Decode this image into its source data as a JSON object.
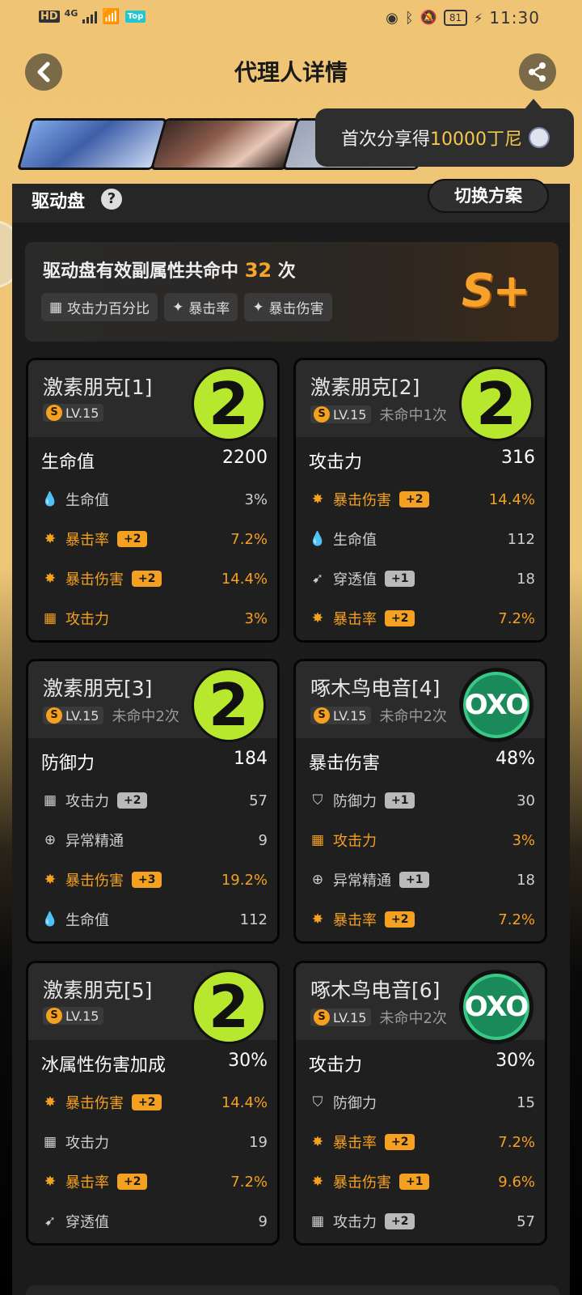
{
  "status_bar": {
    "hd": "HD",
    "net": "4G",
    "top_badge": "Top",
    "battery": "81",
    "time": "11:30"
  },
  "header": {
    "title": "代理人详情",
    "back_icon": "chevron-left-icon",
    "share_icon": "share-icon"
  },
  "tooltip": {
    "prefix": "首次分享得",
    "amount": "10000丁尼"
  },
  "panel": {
    "title": "驱动盘",
    "help": "?",
    "switch_label": "切换方案"
  },
  "summary": {
    "text_prefix": "驱动盘有效副属性共命中",
    "count": "32",
    "text_suffix": "次",
    "tags": [
      "攻击力百分比",
      "暴击率",
      "暴击伤害"
    ],
    "rank": "S+"
  },
  "discs": [
    {
      "name": "激素朋克[1]",
      "level": "LV.15",
      "miss": "",
      "logo": "2",
      "logo_type": "lime",
      "main": {
        "label": "生命值",
        "value": "2200"
      },
      "subs": [
        {
          "icon": "hp-icon",
          "label": "生命值",
          "plus": "",
          "value": "3%",
          "hit": false
        },
        {
          "icon": "crit-rate-icon",
          "label": "暴击率",
          "plus": "+2",
          "value": "7.2%",
          "hit": true
        },
        {
          "icon": "crit-dmg-icon",
          "label": "暴击伤害",
          "plus": "+2",
          "value": "14.4%",
          "hit": true
        },
        {
          "icon": "atk-icon",
          "label": "攻击力",
          "plus": "",
          "value": "3%",
          "hit": true
        }
      ]
    },
    {
      "name": "激素朋克[2]",
      "level": "LV.15",
      "miss": "未命中1次",
      "logo": "2",
      "logo_type": "lime",
      "main": {
        "label": "攻击力",
        "value": "316"
      },
      "subs": [
        {
          "icon": "crit-dmg-icon",
          "label": "暴击伤害",
          "plus": "+2",
          "value": "14.4%",
          "hit": true
        },
        {
          "icon": "hp-icon",
          "label": "生命值",
          "plus": "",
          "value": "112",
          "hit": false
        },
        {
          "icon": "pen-icon",
          "label": "穿透值",
          "plus": "+1",
          "value": "18",
          "hit": false
        },
        {
          "icon": "crit-rate-icon",
          "label": "暴击率",
          "plus": "+2",
          "value": "7.2%",
          "hit": true
        }
      ]
    },
    {
      "name": "激素朋克[3]",
      "level": "LV.15",
      "miss": "未命中2次",
      "logo": "2",
      "logo_type": "lime",
      "main": {
        "label": "防御力",
        "value": "184"
      },
      "subs": [
        {
          "icon": "atk-icon",
          "label": "攻击力",
          "plus": "+2",
          "value": "57",
          "hit": false
        },
        {
          "icon": "anomaly-icon",
          "label": "异常精通",
          "plus": "",
          "value": "9",
          "hit": false
        },
        {
          "icon": "crit-dmg-icon",
          "label": "暴击伤害",
          "plus": "+3",
          "value": "19.2%",
          "hit": true
        },
        {
          "icon": "hp-icon",
          "label": "生命值",
          "plus": "",
          "value": "112",
          "hit": false
        }
      ]
    },
    {
      "name": "啄木鸟电音[4]",
      "level": "LV.15",
      "miss": "未命中2次",
      "logo": "OXO",
      "logo_type": "oxo",
      "main": {
        "label": "暴击伤害",
        "value": "48%"
      },
      "subs": [
        {
          "icon": "def-icon",
          "label": "防御力",
          "plus": "+1",
          "value": "30",
          "hit": false
        },
        {
          "icon": "atk-icon",
          "label": "攻击力",
          "plus": "",
          "value": "3%",
          "hit": true
        },
        {
          "icon": "anomaly-icon",
          "label": "异常精通",
          "plus": "+1",
          "value": "18",
          "hit": false
        },
        {
          "icon": "crit-rate-icon",
          "label": "暴击率",
          "plus": "+2",
          "value": "7.2%",
          "hit": true
        }
      ]
    },
    {
      "name": "激素朋克[5]",
      "level": "LV.15",
      "miss": "",
      "logo": "2",
      "logo_type": "lime",
      "main": {
        "label": "冰属性伤害加成",
        "value": "30%"
      },
      "subs": [
        {
          "icon": "crit-dmg-icon",
          "label": "暴击伤害",
          "plus": "+2",
          "value": "14.4%",
          "hit": true
        },
        {
          "icon": "atk-icon",
          "label": "攻击力",
          "plus": "",
          "value": "19",
          "hit": false
        },
        {
          "icon": "crit-rate-icon",
          "label": "暴击率",
          "plus": "+2",
          "value": "7.2%",
          "hit": true
        },
        {
          "icon": "pen-icon",
          "label": "穿透值",
          "plus": "",
          "value": "9",
          "hit": false
        }
      ]
    },
    {
      "name": "啄木鸟电音[6]",
      "level": "LV.15",
      "miss": "未命中2次",
      "logo": "OXO",
      "logo_type": "oxo",
      "main": {
        "label": "攻击力",
        "value": "30%"
      },
      "subs": [
        {
          "icon": "def-icon",
          "label": "防御力",
          "plus": "",
          "value": "15",
          "hit": false
        },
        {
          "icon": "crit-rate-icon",
          "label": "暴击率",
          "plus": "+2",
          "value": "7.2%",
          "hit": true
        },
        {
          "icon": "crit-dmg-icon",
          "label": "暴击伤害",
          "plus": "+1",
          "value": "9.6%",
          "hit": true
        },
        {
          "icon": "atk-icon",
          "label": "攻击力",
          "plus": "+2",
          "value": "57",
          "hit": false
        }
      ]
    }
  ]
}
